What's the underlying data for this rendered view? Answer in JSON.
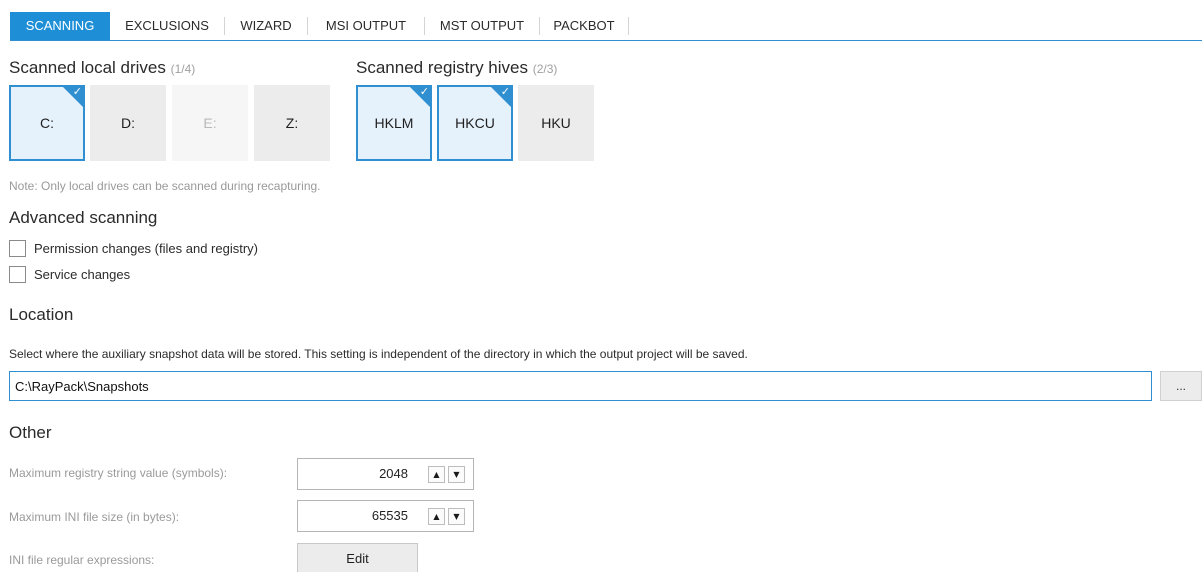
{
  "tabs": [
    "SCANNING",
    "EXCLUSIONS",
    "WIZARD",
    "MSI OUTPUT",
    "MST OUTPUT",
    "PACKBOT"
  ],
  "drives": {
    "title": "Scanned local drives",
    "count": "(1/4)",
    "items": [
      {
        "label": "C:",
        "state": "selected"
      },
      {
        "label": "D:",
        "state": "normal"
      },
      {
        "label": "E:",
        "state": "disabled"
      },
      {
        "label": "Z:",
        "state": "normal"
      }
    ]
  },
  "hives": {
    "title": "Scanned registry hives",
    "count": "(2/3)",
    "items": [
      {
        "label": "HKLM",
        "state": "selected"
      },
      {
        "label": "HKCU",
        "state": "selected"
      },
      {
        "label": "HKU",
        "state": "normal"
      }
    ]
  },
  "note": "Note: Only local drives can be scanned during recapturing.",
  "advanced": {
    "title": "Advanced scanning",
    "options": [
      {
        "label": "Permission changes (files and registry)",
        "checked": false
      },
      {
        "label": "Service changes",
        "checked": false
      }
    ]
  },
  "location": {
    "title": "Location",
    "description": "Select where the auxiliary snapshot data will be stored. This setting is independent of the directory in which the output project will be saved.",
    "path": "C:\\RayPack\\Snapshots",
    "browse_label": "..."
  },
  "other": {
    "title": "Other",
    "max_registry_label": "Maximum registry string value (symbols):",
    "max_registry_value": "2048",
    "max_ini_label": "Maximum INI file size (in bytes):",
    "max_ini_value": "65535",
    "regex_label": "INI file regular expressions:",
    "edit_label": "Edit"
  },
  "icons": {
    "up": "▲",
    "down": "▼",
    "check": "✓"
  },
  "colors": {
    "accent": "#1e8fd6",
    "selected_bg": "#e5f1fb",
    "tile_bg": "#ececec"
  }
}
